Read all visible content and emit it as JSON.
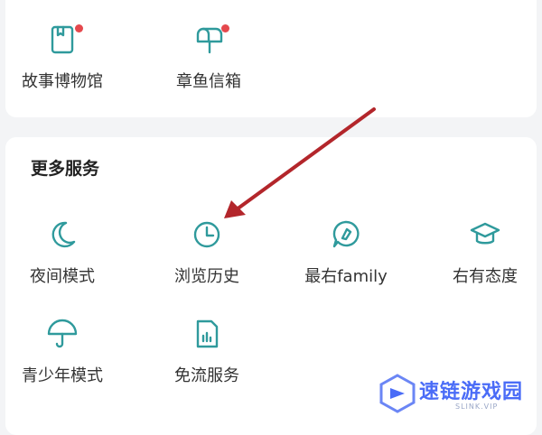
{
  "top_section": {
    "items": [
      {
        "label": "故事博物馆",
        "icon": "book-icon",
        "badge": true
      },
      {
        "label": "章鱼信箱",
        "icon": "mailbox-icon",
        "badge": true
      }
    ]
  },
  "more_services": {
    "title": "更多服务",
    "items": [
      {
        "label": "夜间模式",
        "icon": "moon-icon"
      },
      {
        "label": "浏览历史",
        "icon": "clock-icon"
      },
      {
        "label": "最右family",
        "icon": "family-icon"
      },
      {
        "label": "右有态度",
        "icon": "graduation-cap-icon"
      },
      {
        "label": "青少年模式",
        "icon": "umbrella-icon"
      },
      {
        "label": "免流服务",
        "icon": "sim-card-icon"
      }
    ]
  },
  "watermark": {
    "text": "速链游戏园",
    "sub": "SLINK.VIP"
  },
  "colors": {
    "icon_teal": "#2f9a9c",
    "badge_red": "#e5484d",
    "arrow_red": "#b3262b",
    "watermark_blue": "#4a6cf7"
  }
}
